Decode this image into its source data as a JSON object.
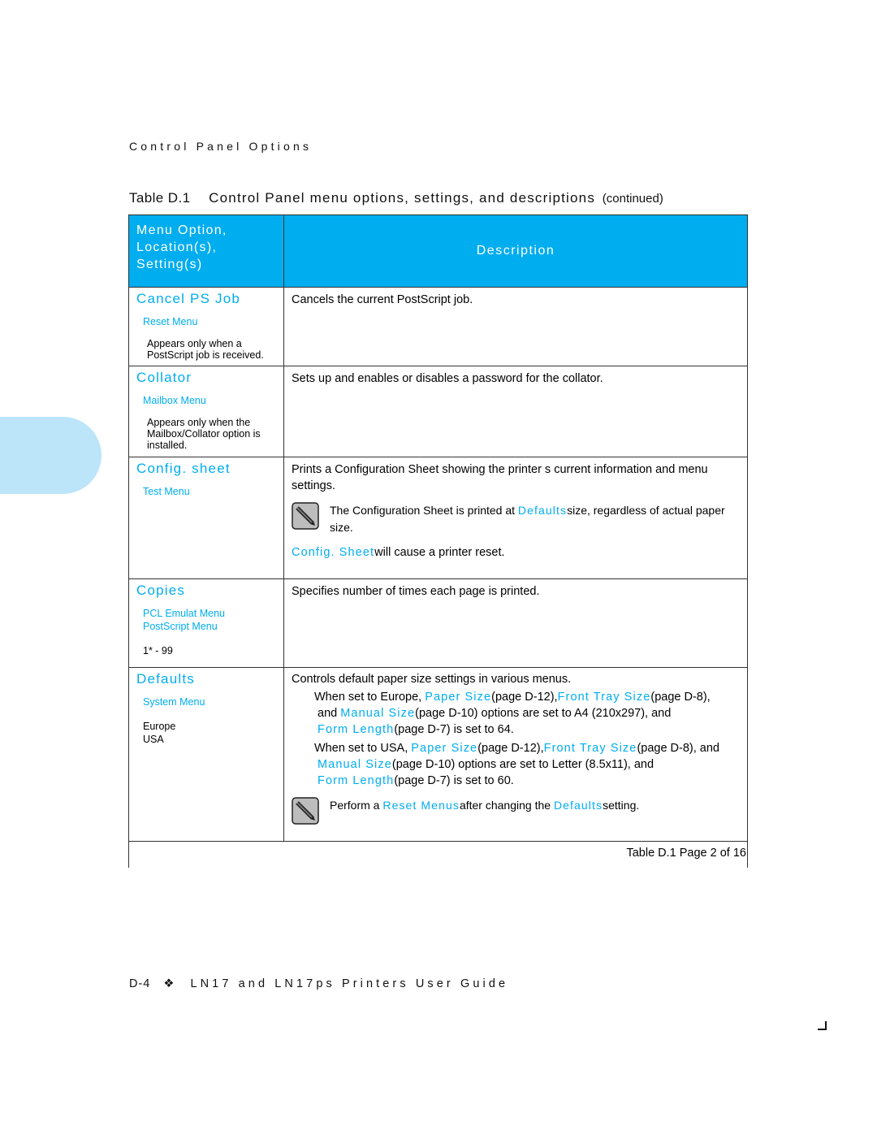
{
  "running_head": "Control Panel Options",
  "caption": {
    "number": "Table D.1",
    "title": "Control Panel menu options, settings, and descriptions",
    "continued": "(continued)"
  },
  "table": {
    "header": {
      "col1_lines": [
        "Menu Option,",
        "Location(s),",
        "Setting(s)"
      ],
      "col2": "Description"
    },
    "rows": [
      {
        "option": "Cancel PS Job",
        "locations": [
          "Reset Menu"
        ],
        "note": "Appears only when a PostScript job is received.",
        "description": "Cancels the current PostScript job."
      },
      {
        "option": "Collator",
        "locations": [
          "Mailbox Menu"
        ],
        "note": "Appears only when the Mailbox/Collator option is installed.",
        "description": "Sets up and enables or disables a password for the collator."
      },
      {
        "option": "Config. sheet",
        "locations": [
          "Test Menu"
        ],
        "description": "Prints a Configuration Sheet showing the printer s current information and menu settings.",
        "note_box": {
          "icon": "pencil-note-icon",
          "before": "The Configuration Sheet is printed at ",
          "link": "Defaults",
          "after": "size, regardless of actual paper size."
        },
        "extra": {
          "link": "Config. Sheet",
          "after": "will cause a printer reset."
        }
      },
      {
        "option": "Copies",
        "locations": [
          "PCL Emulat Menu",
          "PostScript Menu"
        ],
        "settings": [
          "1* - 99"
        ],
        "description": "Specifies number of times each page is printed."
      },
      {
        "option": "Defaults",
        "locations": [
          "System Menu"
        ],
        "settings": [
          "Europe",
          "USA"
        ],
        "description": "Controls default paper size settings in various menus.",
        "europe": {
          "t1": "When set to Europe, ",
          "l1": "Paper Size",
          "t2": "(page D-12),",
          "l2": "Front Tray Size",
          "t3": "(page D-8),",
          "t4": "and ",
          "l3": "Manual Size",
          "t5": "(page D-10) options are set to A4 (210x297), and",
          "l4": "Form Length",
          "t6": "(page D-7) is set to 64."
        },
        "usa": {
          "t1": "When set to USA, ",
          "l1": "Paper Size",
          "t2": "(page D-12),",
          "l2": "Front Tray Size",
          "t3": "(page D-8), and",
          "l3": "Manual Size",
          "t5": "(page D-10) options are set to Letter (8.5x11), and",
          "l4": "Form Length",
          "t6": "(page D-7) is set to 60."
        },
        "note_box": {
          "icon": "pencil-note-icon",
          "before": "Perform a ",
          "link1": "Reset Menus",
          "middle": "after changing the ",
          "link2": "Defaults",
          "after": "setting."
        }
      }
    ],
    "footer": "Table D.1  Page 2 of 16"
  },
  "page_footer": {
    "page": "D-4",
    "separator": "❖",
    "guide": "LN17 and LN17ps Printers User Guide"
  },
  "colors": {
    "accent": "#00adef",
    "thumb_tab": "#bde5fa"
  }
}
